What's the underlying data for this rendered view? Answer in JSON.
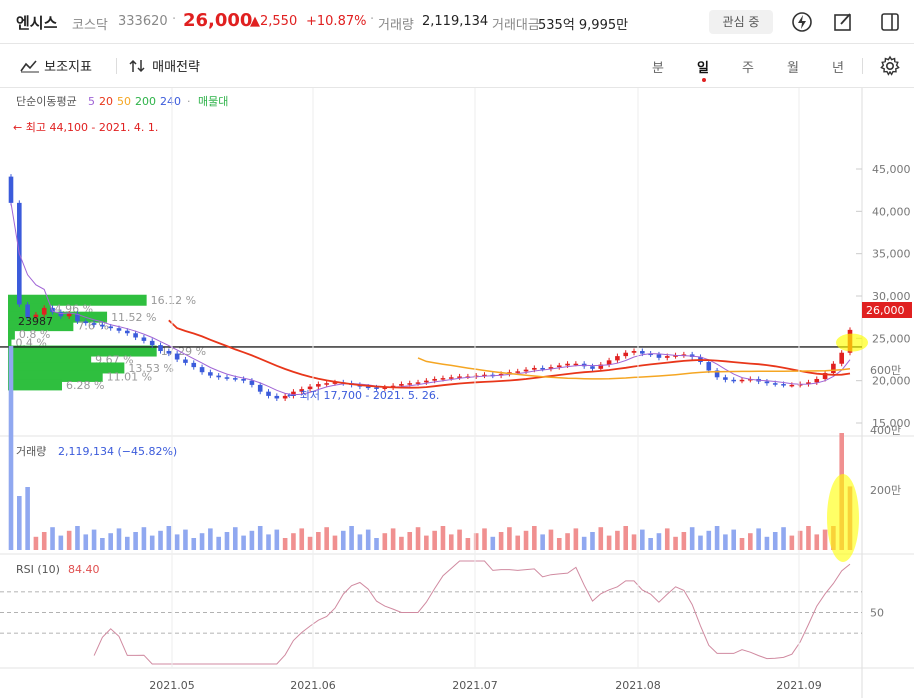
{
  "header": {
    "name": "엔시스",
    "market": "코스닥",
    "code": "333620",
    "price": "26,000",
    "change": "▲2,550",
    "change_pct": "+10.87%",
    "volume_label": "거래량",
    "volume_value": "2,119,134",
    "amount_label": "거래대금",
    "amount_value": "535억 9,995만",
    "favorite_label": "관심 중",
    "colors": {
      "up": "#e02020",
      "down": "#3b5bdb"
    }
  },
  "toolbar": {
    "indicator_label": "보조지표",
    "strategy_label": "매매전략",
    "periods": [
      "분",
      "일",
      "주",
      "월",
      "년"
    ],
    "selected_period": "일"
  },
  "chart_data": [
    {
      "type": "candlestick",
      "title": "",
      "legend": {
        "label": "단순이동평균",
        "periods": [
          "5",
          "20",
          "50",
          "200",
          "240"
        ],
        "colors": [
          "#a065d6",
          "#e8361a",
          "#f5a623",
          "#2fb34a",
          "#3b5bdb"
        ],
        "extra": "매물대",
        "dot": "·"
      },
      "y_ticks": [
        "45,000",
        "40,000",
        "35,000",
        "30,000",
        "25,000",
        "20,000",
        "15,000"
      ],
      "ylim": [
        14000,
        47000
      ],
      "x_ticks": [
        "2021.05",
        "2021.06",
        "2021.07",
        "2021.08",
        "2021.09"
      ],
      "current_price_label": "26,000",
      "reference_line": {
        "value": 23987,
        "label": "23987"
      },
      "annotations": {
        "high": "← 최고 44,100 - 2021. 4. 1.",
        "low": "← 최저 17,700 - 2021. 5. 26."
      },
      "volume_profile": [
        {
          "price": 29500,
          "pct": "16.12 %",
          "value": 16.12
        },
        {
          "price": 28500,
          "pct": "4.96 %",
          "value": 4.96
        },
        {
          "price": 27500,
          "pct": "11.52 %",
          "value": 11.52
        },
        {
          "price": 26500,
          "pct": "7.6 %",
          "value": 7.6
        },
        {
          "price": 25500,
          "pct": "0.8 %",
          "value": 0.8
        },
        {
          "price": 24500,
          "pct": "0.4 %",
          "value": 0.4
        },
        {
          "price": 23500,
          "pct": "17.29 %",
          "value": 17.29
        },
        {
          "price": 22500,
          "pct": "9.67 %",
          "value": 9.67
        },
        {
          "price": 21500,
          "pct": "13.53 %",
          "value": 13.53
        },
        {
          "price": 20500,
          "pct": "11.01 %",
          "value": 11.01
        },
        {
          "price": 19500,
          "pct": "6.28 %",
          "value": 6.28
        }
      ]
    },
    {
      "type": "bar",
      "title": "거래량",
      "value_label": "2,119,134 (−45.82%)",
      "y_ticks": [
        "600만",
        "400만",
        "200만"
      ],
      "ylim": [
        0,
        7000000
      ]
    },
    {
      "type": "line",
      "title": "RSI (10)",
      "value_label": "84.40",
      "y_ticks": [
        "50"
      ],
      "ylim": [
        0,
        100
      ]
    }
  ]
}
